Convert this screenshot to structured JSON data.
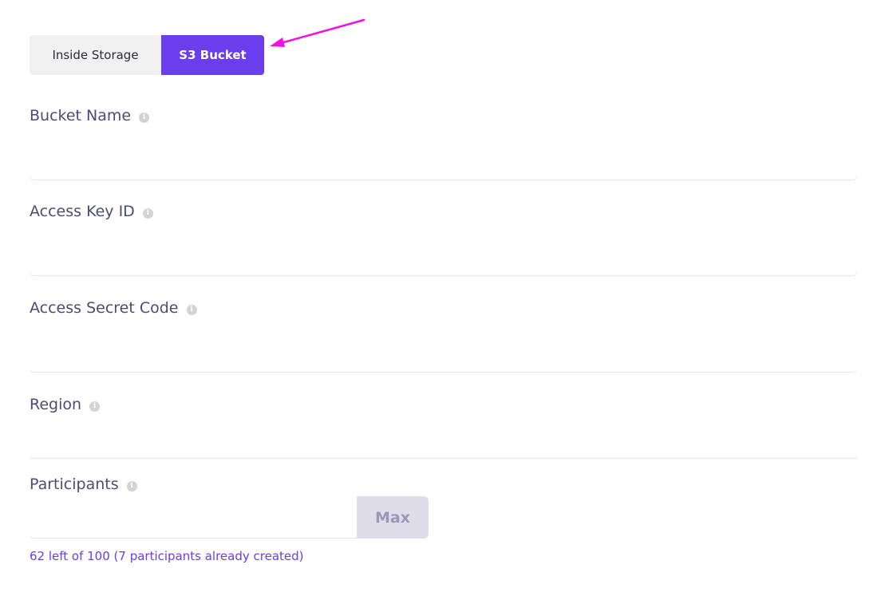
{
  "storage_toggle": {
    "options": [
      "Inside Storage",
      "S3 Bucket"
    ],
    "selected": "S3 Bucket",
    "active_color": "#6a3ded"
  },
  "annotation_color": "#f012e0",
  "fields": {
    "bucket_name": {
      "label": "Bucket Name",
      "value": ""
    },
    "access_key_id": {
      "label": "Access Key ID",
      "value": ""
    },
    "access_secret_code": {
      "label": "Access Secret Code",
      "value": ""
    },
    "region": {
      "label": "Region",
      "value": ""
    }
  },
  "info_icon": "info-icon",
  "participants": {
    "label": "Participants",
    "value": "",
    "max_label": "Max",
    "hint": "62 left of 100 (7 participants already created)",
    "remaining": 62,
    "total": 100,
    "created": 7
  }
}
